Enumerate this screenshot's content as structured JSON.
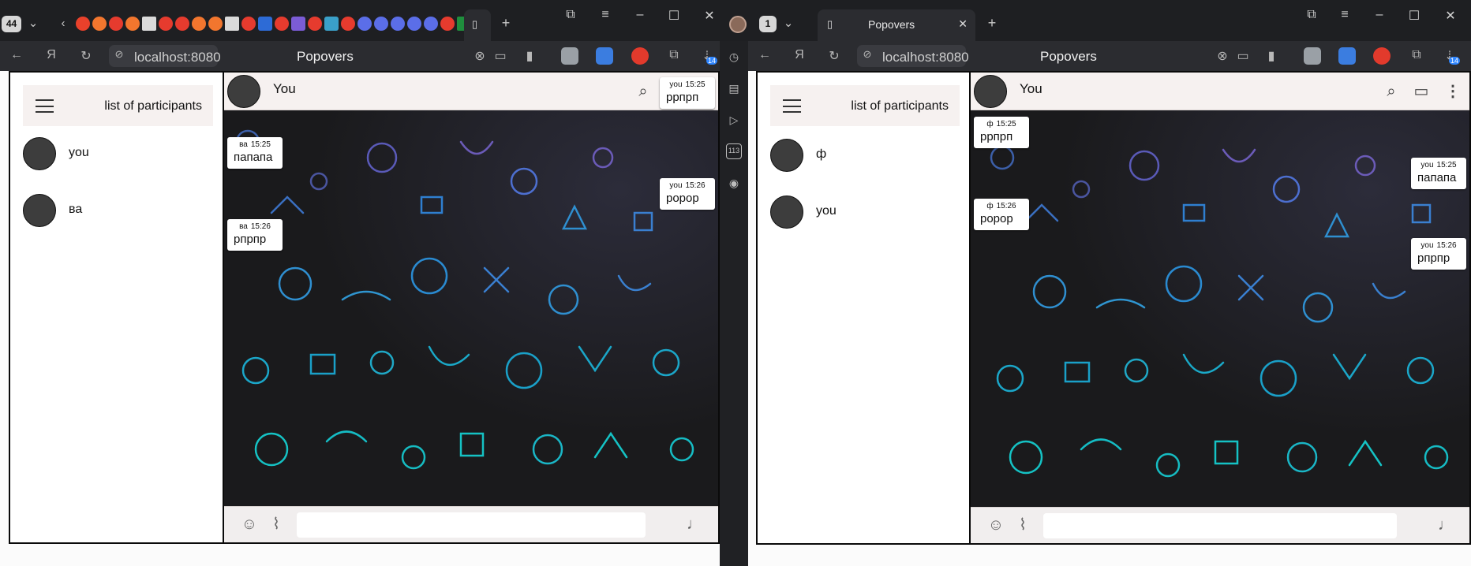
{
  "left_window": {
    "tab_count": "44",
    "address": {
      "host": "localhost:8080",
      "page_title": "Popovers",
      "ext_badge": "14"
    },
    "sidebar": {
      "title": "list of participants",
      "participants": [
        {
          "name": "you"
        },
        {
          "name": "ва"
        }
      ]
    },
    "chat": {
      "header_name": "You",
      "messages": [
        {
          "author": "you",
          "time": "15:25",
          "text": "ррпрп",
          "side": "right"
        },
        {
          "author": "ва",
          "time": "15:25",
          "text": "папапа",
          "side": "left"
        },
        {
          "author": "you",
          "time": "15:26",
          "text": "ророр",
          "side": "right"
        },
        {
          "author": "ва",
          "time": "15:26",
          "text": "рпрпр",
          "side": "left"
        }
      ]
    }
  },
  "right_window": {
    "tab_count": "1",
    "tab_title": "Popovers",
    "address": {
      "host": "localhost:8080",
      "page_title": "Popovers",
      "ext_badge": "14"
    },
    "rail_badge": "113",
    "sidebar": {
      "title": "list of participants",
      "participants": [
        {
          "name": "ф"
        },
        {
          "name": "you"
        }
      ]
    },
    "chat": {
      "header_name": "You",
      "messages": [
        {
          "author": "ф",
          "time": "15:25",
          "text": "ррпрп",
          "side": "left"
        },
        {
          "author": "you",
          "time": "15:25",
          "text": "папапа",
          "side": "right"
        },
        {
          "author": "ф",
          "time": "15:26",
          "text": "ророр",
          "side": "left"
        },
        {
          "author": "you",
          "time": "15:26",
          "text": "рпрпр",
          "side": "right"
        }
      ]
    }
  },
  "icons": {
    "menu": "hamburger-icon",
    "search": "search-icon",
    "video": "video-camera-icon",
    "more": "more-vertical-icon",
    "emoji": "emoji-icon",
    "attach": "paperclip-icon",
    "mic": "microphone-icon"
  },
  "colors": {
    "chat_header": "#f6f1f0",
    "doodle_blue": "#2f7fd0",
    "doodle_teal": "#15c2c4",
    "doodle_purple": "#6b5bb8"
  }
}
